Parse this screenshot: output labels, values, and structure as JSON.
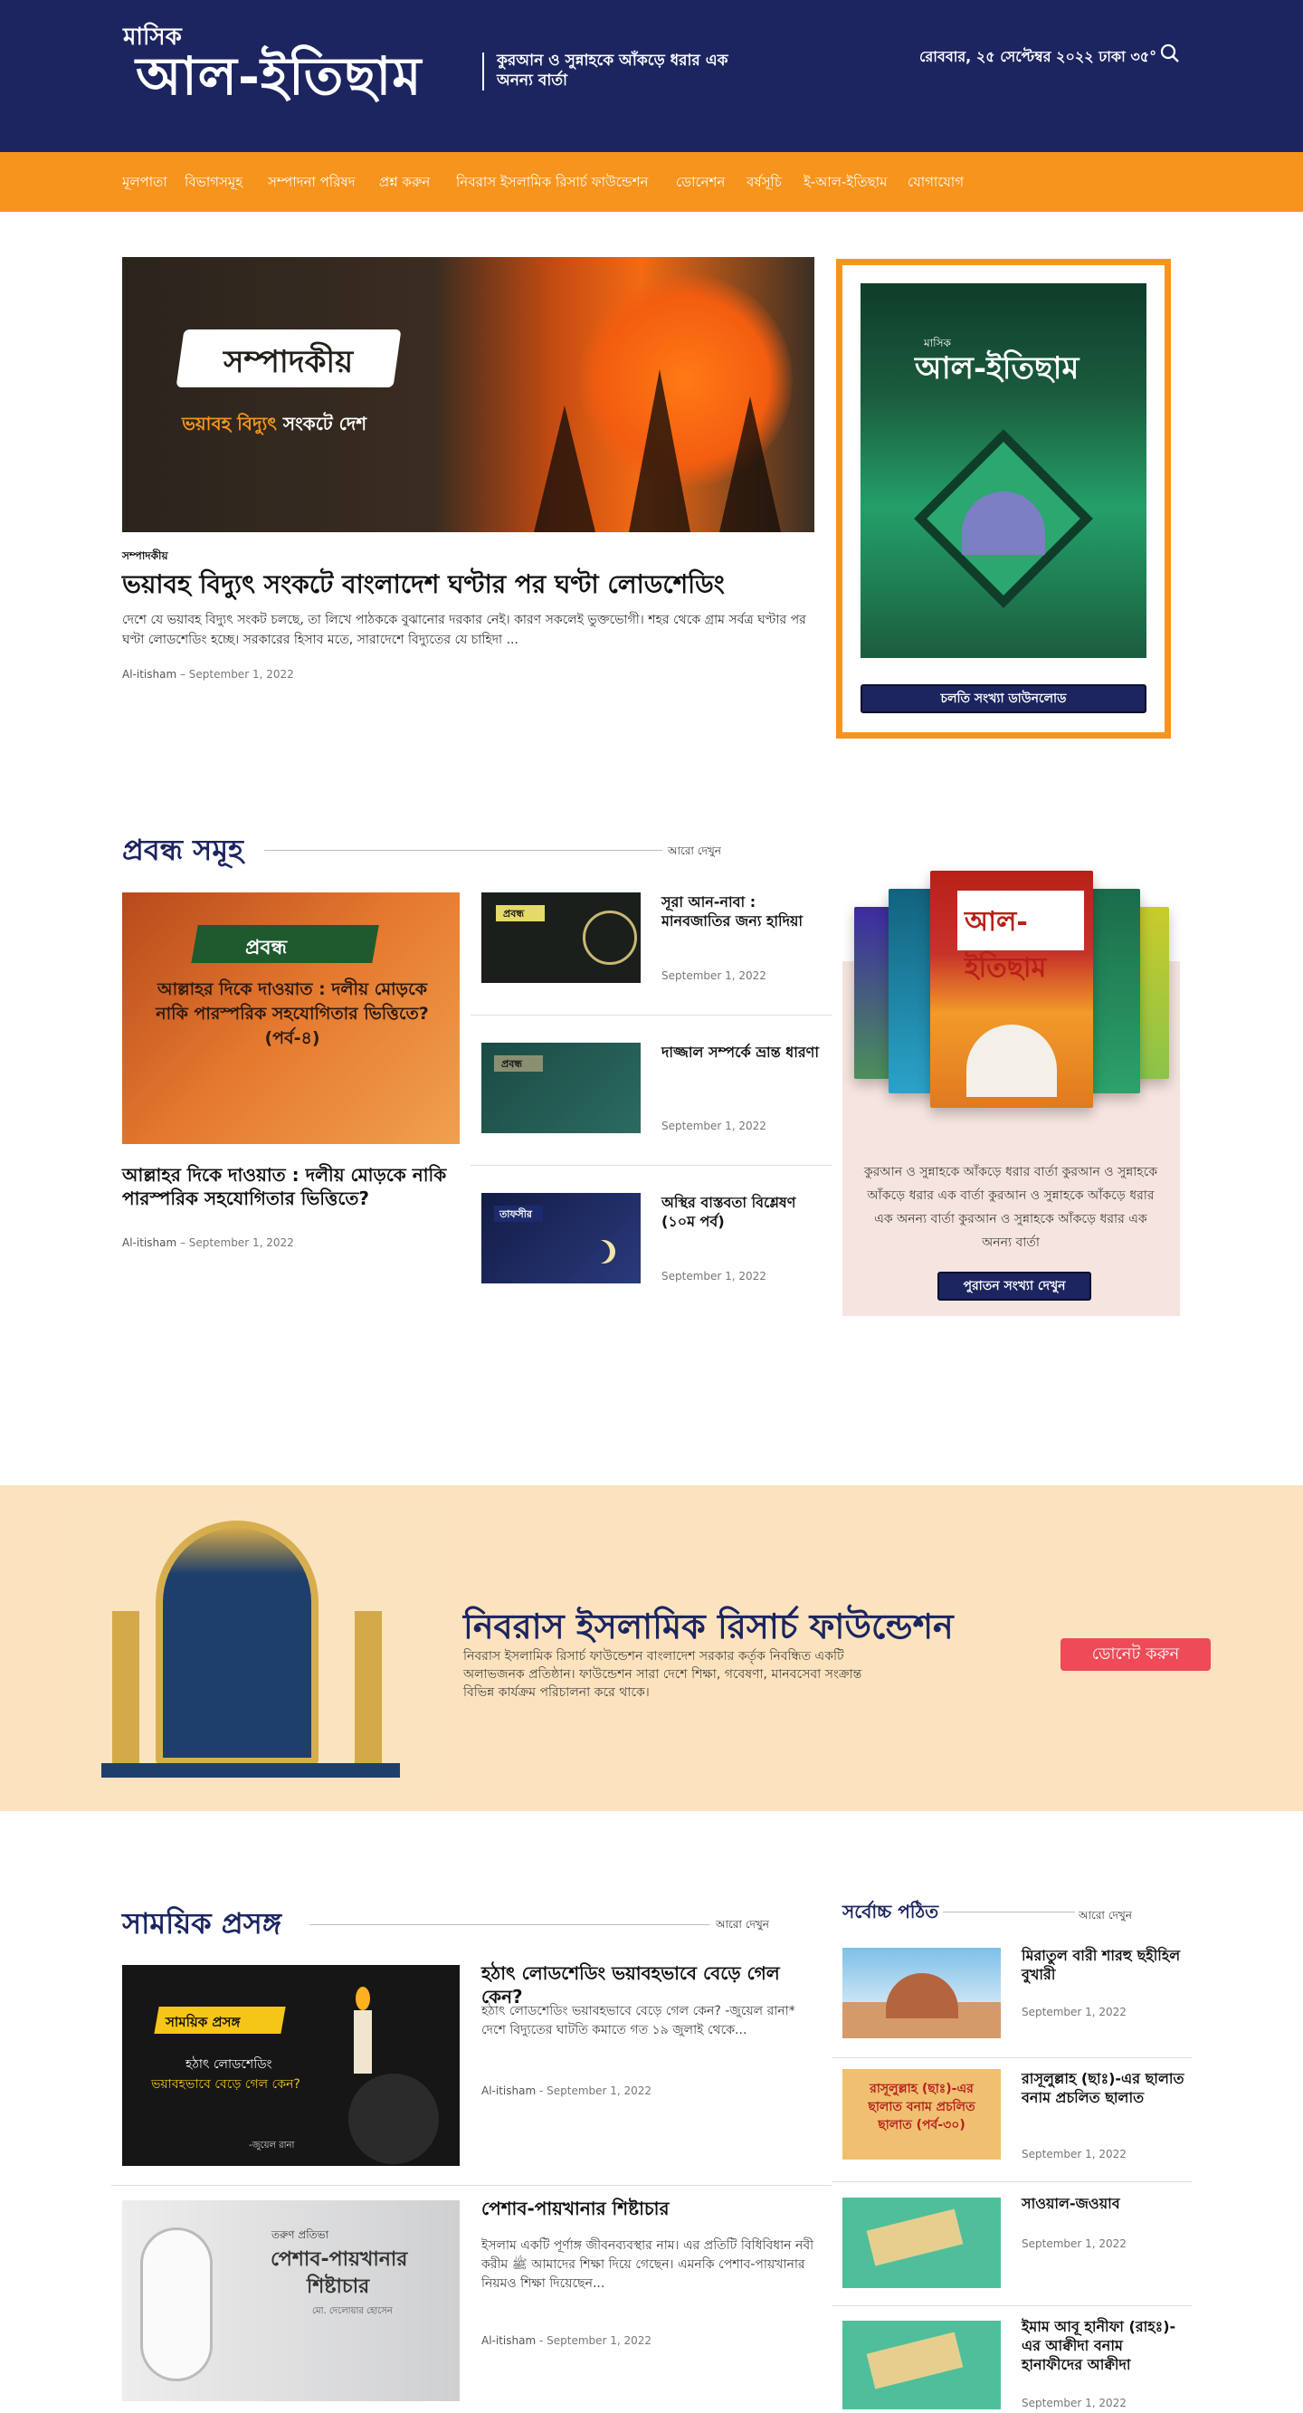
{
  "header": {
    "logo_small": "মাসিক",
    "logo_big": "আল-ইতিছাম",
    "tagline": "কুরআন ও সুন্নাহকে আঁকড়ে ধরার এক অনন্য বার্তা",
    "date": "রোববার, ২৫ সেপ্টেম্বর ২০২২ ঢাকা ৩৫°"
  },
  "nav": {
    "items": [
      "মূলপাতা",
      "বিভাগসমূহ",
      "সম্পাদনা পরিষদ",
      "প্রশ্ন করুন",
      "নিবরাস ইসলামিক রিসার্চ ফাউন্ডেশন",
      "ডোনেশন",
      "বর্ষসূচি",
      "ই-আল-ইতিছাম",
      "যোগাযোগ"
    ]
  },
  "featured": {
    "image_brush": "সম্পাদকীয়",
    "image_sub_em": "ভয়াবহ বিদ্যুৎ",
    "image_sub": "সংকটে দেশ",
    "category": "সম্পাদকীয়",
    "title": "ভয়াবহ বিদ্যুৎ সংকটে বাংলাদেশ ঘণ্টার পর ঘণ্টা লোডশেডিং",
    "excerpt": "দেশে যে ভয়াবহ বিদ্যুৎ সংকট চলছে, তা লিখে পাঠককে বুঝানোর দরকার নেই। কারণ সকলেই ভুক্তভোগী। শহর থেকে গ্রাম সর্বত্র ঘণ্টার পর ঘণ্টা লোডশেডিং হচ্ছে। সরকারের হিসাব মতে, সারাদেশে বিদ্যুতের যে চাহিদা ...",
    "author": "Al-itisham",
    "date": "September 1, 2022"
  },
  "cover": {
    "small": "মাসিক",
    "title": "আল-ইতিছাম",
    "button": "চলতি সংখ্যা ডাউনলোড"
  },
  "articles": {
    "title": "প্রবন্ধ সমূহ",
    "see_more": "আরো দেখুন",
    "main": {
      "image_label": "প্রবন্ধ",
      "image_title": "আল্লাহর দিকে দাওয়াত : দলীয় মোড়কে নাকি পারস্পরিক সহযোগিতার ভিত্তিতে? (পর্ব-৪)",
      "title": "আল্লাহর দিকে দাওয়াত : দলীয় মোড়কে নাকি পারস্পরিক সহযোগিতার ভিত্তিতে?",
      "author": "Al-itisham",
      "date": "September 1, 2022"
    },
    "list": [
      {
        "title": "সূরা আন-নাবা : মানবজাতির জন্য হাদিয়া",
        "date": "September 1, 2022",
        "badge": "প্রবন্ধ"
      },
      {
        "title": "দাজ্জাল সম্পর্কে ভ্রান্ত ধারণা",
        "date": "September 1, 2022",
        "badge": "প্রবন্ধ"
      },
      {
        "title": "অস্থির বাস্তবতা বিশ্লেষণ (১০ম পর্ব)",
        "date": "September 1, 2022",
        "badge": "তাফসীর"
      }
    ]
  },
  "promo": {
    "text": "কুরআন ও সুন্নাহকে আঁকড়ে ধরার বার্তা কুরআন ও সুন্নাহকে আঁকড়ে ধরার এক বার্তা কুরআন ও সুন্নাহকে আঁকড়ে ধরার এক অনন্য বার্তা কুরআন ও সুন্নাহকে আঁকড়ে ধরার এক অনন্য বার্তা",
    "button": "পুরাতন সংখ্যা দেখুন",
    "book_title": "আল-ইতিছাম"
  },
  "banner": {
    "title": "নিবরাস ইসলামিক রিসার্চ ফাউন্ডেশন",
    "text": "নিবরাস ইসলামিক রিসার্চ ফাউন্ডেশন বাংলাদেশ সরকার কর্তৃক নিবন্ধিত একটি অলাভজনক প্রতিষ্ঠান। ফাউন্ডেশন সারা দেশে শিক্ষা, গবেষণা, মানবসেবা সংক্রান্ত বিভিন্ন কার্যক্রম পরিচালনা করে থাকে।",
    "button": "ডোনেট করুন"
  },
  "current": {
    "title": "সাময়িক প্রসঙ্গ",
    "see_more": "আরো দেখুন",
    "items": [
      {
        "title": "হঠাৎ লোডশেডিং ভয়াবহভাবে বেড়ে গেল কেন?",
        "excerpt": "হঠাৎ লোডশেডিং ভয়াবহভাবে বেড়ে গেল কেন? -জুয়েল রানা* দেশে বিদ্যুতের ঘাটতি কমাতে গত ১৯ জুলাই থেকে...",
        "author": "Al-itisham",
        "date": "September 1, 2022",
        "image_label": "সাময়িক প্রসঙ্গ",
        "image_text": "হঠাৎ লোডশেডিং",
        "image_em": "ভয়াবহভাবে বেড়ে গেল কেন?",
        "image_author": "-জুয়েল রানা"
      },
      {
        "title": "পেশাব-পায়খানার শিষ্টাচার",
        "excerpt": "ইসলাম একটি পূর্ণাঙ্গ জীবনব্যবস্থার নাম। এর প্রতিটি বিধিবিধান নবী করীম ﷺ আমাদের শিক্ষা দিয়ে গেছেন। এমনকি পেশাব-পায়খানার নিয়মও শিক্ষা দিয়েছেন...",
        "author": "Al-itisham",
        "date": "September 1, 2022",
        "image_label": "তরুণ প্রতিভা",
        "image_text": "পেশাব-পায়খানার",
        "image_em": "শিষ্টাচার",
        "image_author": "মো. দেলোয়ার হোসেন"
      }
    ]
  },
  "popular": {
    "title": "সর্বোচ্চ পঠিত",
    "see_more": "আরো দেখুন",
    "items": [
      {
        "title": "মিরাতুল বারী শারহু ছহীহিল বুখারী",
        "date": "September 1, 2022"
      },
      {
        "title": "রাসূলুল্লাহ (ছাঃ)-এর ছালাত বনাম প্রচলিত ছালাত",
        "date": "September 1, 2022",
        "image_text": "রাসূলুল্লাহ (ছাঃ)-এর ছালাত বনাম প্রচলিত ছালাত (পর্ব-৩০)"
      },
      {
        "title": "সাওয়াল-জওয়াব",
        "date": "September 1, 2022"
      },
      {
        "title": "ইমাম আবূ হানীফা (রাহঃ)-এর আক্বীদা বনাম হানাফীদের আক্বীদা",
        "date": "September 1, 2022"
      }
    ]
  },
  "colors": {
    "navy": "#1c2560",
    "orange": "#f7941d",
    "donate": "#ef4a57",
    "cream": "#fce3bd"
  }
}
